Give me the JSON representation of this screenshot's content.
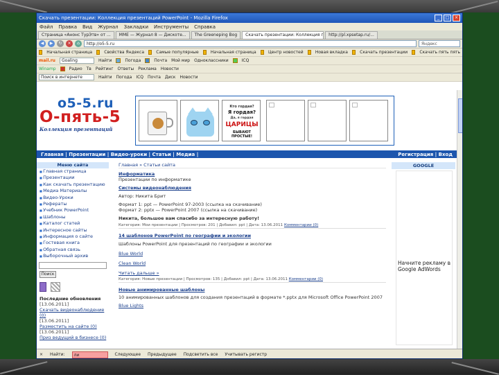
{
  "browser": {
    "title": "Скачать презентации: Коллекция презентаций PowerPoint - Mozilla Firefox",
    "menu": [
      "Файл",
      "Правка",
      "Вид",
      "Журнал",
      "Закладки",
      "Инструменты",
      "Справка"
    ],
    "tabs": [
      "Страница «Анонс ТурЭтв» от ...",
      "ММЕ — Журнал 8 — Дискоте...",
      "The Greeneping Bog",
      "Скачать презентации: Коллекция презентаций",
      "http://pl.xpsetap.ru/..."
    ],
    "url": "http://o5-5.ru",
    "search_placeholder": "Яндекс",
    "bookmarks": [
      "Начальная страница",
      "Свойства Яндекса",
      "Самые популярные",
      "Начальная страница",
      "Центр новостей",
      "Новая вкладка",
      "Скачать презентации",
      "Скачать пять пять"
    ],
    "toolbar2": [
      "mail.ru",
      "Goaling",
      "Найти",
      "Погода",
      "Почта",
      "Мой мир",
      "Одноклассники",
      "ICQ"
    ],
    "toolbar3": [
      "Winamp",
      "Радио",
      "Тв",
      "Рейтинг",
      "Ответы",
      "Реклама",
      "Новости"
    ],
    "toolbar4": [
      "Поиск в интернете",
      "Найти",
      "Погода",
      "ICQ",
      "Почта",
      "Диск",
      "Новости"
    ],
    "status": {
      "find_label": "Найти:",
      "find_value": "ли",
      "next": "Следующее",
      "prev": "Предыдущее",
      "highlight": "Подсветить все",
      "case": "Учитывать регистр"
    }
  },
  "site": {
    "logo_top": "o5-5.ru",
    "logo_main": "О-пять-5",
    "logo_sub": "Коллекция презентаций",
    "banner_text": [
      "Кто гордая?",
      "Я гордая?",
      "Да, я гордая",
      "ЦАРИЦЫ",
      "БЫВАЮТ ПРОСТЫЕ!"
    ],
    "nav": "Главная | Презентации | Видео-уроки | Статьи | Медиа |",
    "nav_right": "Регистрация | Вход",
    "left_menu_title": "Меню сайта",
    "left_menu": [
      "Главная страница",
      "Презентации",
      "Как скачать презентацию",
      "Медиа Материалы",
      "Видео-Уроки",
      "Рефераты",
      "Учебник PowerPoint",
      "Шаблоны",
      "Каталог статей",
      "Интересное сайты",
      "Информация о сайте",
      "Гостевая книга",
      "Обратная связь",
      "Выборочный архив"
    ],
    "search_button": "Поиск",
    "latest_title": "Последние обновления",
    "latest": [
      {
        "date": "[13.06.2011]",
        "link": "Скачать видеонаблюдение (0)"
      },
      {
        "date": "[13.06.2011]",
        "link": "Разместить на сайте (0)"
      },
      {
        "date": "[13.06.2011]",
        "link": "Приз ведущий в бизнесе (0)"
      }
    ],
    "breadcrumb": "Главная » Статьи сайта",
    "main": {
      "cat1": "Информатика",
      "cat1_desc": "Презентации по информатике",
      "item1": "Системы видеонаблюдения",
      "author": "Автор: Никита Брит",
      "line1": "Формат 1: ppt — PowerPoint 97-2003 (ссылка на скачивание)",
      "line2": "Формат 2: pptx — PowerPoint 2007 (ссылка на скачивание)",
      "thanks": "Никита, большое вам спасибо за интересную работу!",
      "meta1": "Категория: Мои презентации | Просмотров: 201 | Добавил: ppt | Дата: 13.06.2011",
      "comments1": "Комментарии (0)",
      "item2": "14 шаблонов PowerPoint по географии и экологии",
      "item2_desc": "Шаблоны PowerPoint для презентаций по географии и экологии",
      "item3": "Blue World",
      "item4": "Clean World",
      "read_more": "Читать дальше »",
      "meta2": "Категория: Новые презентации | Просмотров: 135 | Добавил: ppt | Дата: 13.06.2011",
      "comments2": "Комментарии (0)",
      "item5": "Новые анимированные шаблоны",
      "item5_desc": "10 анимированных шаблонов для создания презентаций в формате *.pptx для Microsoft Office PowerPoint 2007",
      "item6": "Blue Lights"
    },
    "google_title": "GOOGLE",
    "google_ad": "Начните рекламу в Google AdWords"
  }
}
